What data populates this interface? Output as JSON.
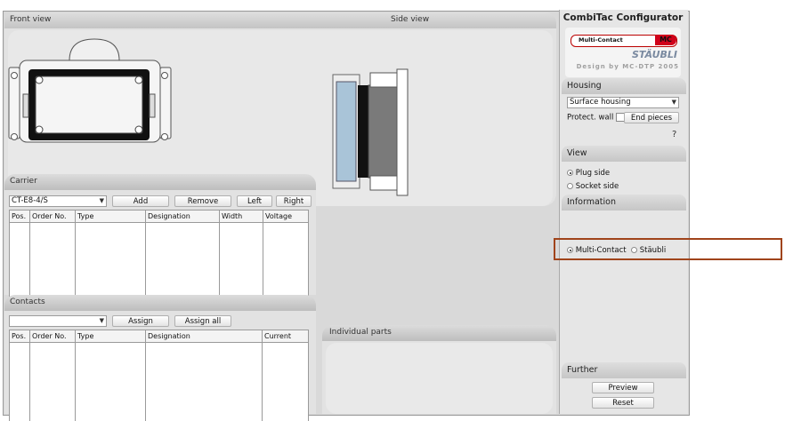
{
  "front_view": {
    "title": "Front view"
  },
  "side_view": {
    "title": "Side view"
  },
  "carrier": {
    "title": "Carrier",
    "select_value": "CT-E8-4/S",
    "add": "Add",
    "remove": "Remove",
    "left": "Left",
    "right": "Right",
    "columns": [
      "Pos.",
      "Order No.",
      "Type",
      "Designation",
      "Width",
      "Voltage"
    ]
  },
  "contacts": {
    "title": "Contacts",
    "select_value": "",
    "assign": "Assign",
    "assign_all": "Assign all",
    "columns": [
      "Pos.",
      "Order No.",
      "Type",
      "Designation",
      "Current"
    ]
  },
  "individual_parts": {
    "title": "Individual parts"
  },
  "configurator": {
    "title": "CombiTac Configurator",
    "logo_left": "Multi-Contact",
    "logo_right": "MC",
    "brand": "STÄUBLI",
    "design_line": "Design by MC-DTP 2005"
  },
  "housing": {
    "title": "Housing",
    "select_value": "Surface housing",
    "protect_wall": "Protect. wall",
    "end_pieces": "End pieces",
    "help": "?"
  },
  "view": {
    "title": "View",
    "plug_side": "Plug side",
    "socket_side": "Socket side"
  },
  "information": {
    "title": "Information",
    "multi_contact": "Multi-Contact",
    "staubli": "Stäubli"
  },
  "further": {
    "title": "Further",
    "preview": "Preview",
    "reset": "Reset"
  }
}
